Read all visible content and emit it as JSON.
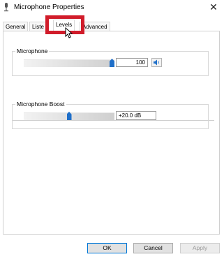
{
  "window": {
    "title": "Microphone Properties",
    "close_glyph": "✕"
  },
  "tabs": [
    {
      "label": "General"
    },
    {
      "label": "Liste"
    },
    {
      "label": "Levels",
      "selected": true
    },
    {
      "label": "Advanced"
    }
  ],
  "levels": {
    "microphone": {
      "label": "Microphone",
      "level_fraction": 1.0,
      "value": "100",
      "mute_icon": "speaker-icon"
    },
    "boost": {
      "label": "Microphone Boost",
      "level_fraction": 0.5,
      "value": "+20.0 dB"
    }
  },
  "buttons": {
    "ok": "OK",
    "cancel": "Cancel",
    "apply": "Apply"
  },
  "colors": {
    "highlight": "#d11c2a",
    "slider_thumb": "#1f6fc9"
  }
}
